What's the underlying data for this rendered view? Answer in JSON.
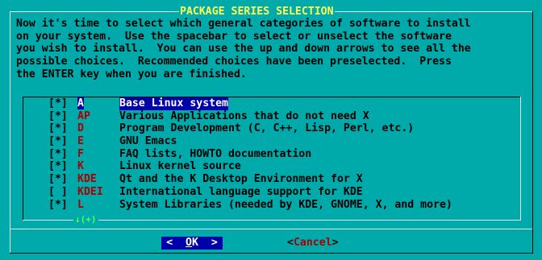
{
  "dialog": {
    "title": "PACKAGE SERIES SELECTION",
    "intro": "Now it's time to select which general categories of software to install\non your system.  Use the spacebar to select or unselect the software\nyou wish to install.  You can use the up and down arrows to see all the\npossible choices.  Recommended choices have been preselected.  Press\nthe ENTER key when you are finished."
  },
  "list": {
    "more_indicator": "↓(+)",
    "items": [
      {
        "check": "[*]",
        "tag": "A",
        "desc": "Base Linux system",
        "selected": true
      },
      {
        "check": "[*]",
        "tag": "AP",
        "desc": "Various Applications that do not need X",
        "selected": false
      },
      {
        "check": "[*]",
        "tag": "D",
        "desc": "Program Development (C, C++, Lisp, Perl, etc.)",
        "selected": false
      },
      {
        "check": "[*]",
        "tag": "E",
        "desc": "GNU Emacs",
        "selected": false
      },
      {
        "check": "[*]",
        "tag": "F",
        "desc": "FAQ lists, HOWTO documentation",
        "selected": false
      },
      {
        "check": "[*]",
        "tag": "K",
        "desc": "Linux kernel source",
        "selected": false
      },
      {
        "check": "[*]",
        "tag": "KDE",
        "desc": "Qt and the K Desktop Environment for X",
        "selected": false
      },
      {
        "check": "[ ]",
        "tag": "KDEI",
        "desc": "International language support for KDE",
        "selected": false
      },
      {
        "check": "[*]",
        "tag": "L",
        "desc": "System Libraries (needed by KDE, GNOME, X, and more)",
        "selected": false
      }
    ]
  },
  "buttons": {
    "ok": {
      "left": "<",
      "hotkey": "O",
      "rest": "K",
      "right": ">"
    },
    "cancel": {
      "left": "<",
      "hotkey": "C",
      "rest": "ancel",
      "right": ">"
    }
  },
  "colors": {
    "background": "#00aaaa",
    "title": "#ffff55",
    "tag": "#aa0000",
    "selection": "#0000aa",
    "more_indicator": "#55ff55"
  }
}
